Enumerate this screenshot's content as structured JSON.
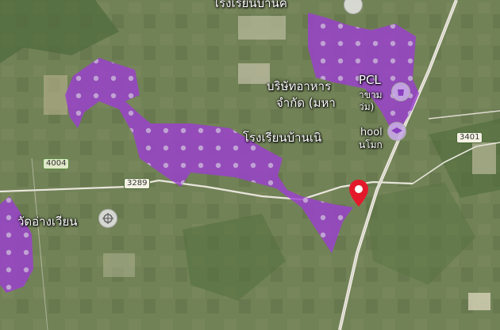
{
  "map": {
    "labels": {
      "top_school": "โรงเรียนบ้านค",
      "company_line1": "บริษัทอาหาร",
      "company_line2": "จำกัด (มหา",
      "pcl": "PCL",
      "pcl_sub1": "าขาม",
      "pcl_sub2": "ว่ม)",
      "school_main": "โรงเรียนบ้านเนิ",
      "school_suffix": "hool",
      "school_suffix2": "นโมก",
      "temple": "วัดอ่างเวียน"
    },
    "road_shields": {
      "r4004": "4004",
      "r3289": "3289",
      "r3401": "3401"
    },
    "icons": {
      "poi_top": "place-icon",
      "poi_pcl": "shopping-icon",
      "poi_school": "school-icon",
      "poi_temple": "temple-icon",
      "marker": "location-pin-icon"
    },
    "colors": {
      "overlay": "#9b3fcf",
      "marker": "#e3192b"
    }
  }
}
